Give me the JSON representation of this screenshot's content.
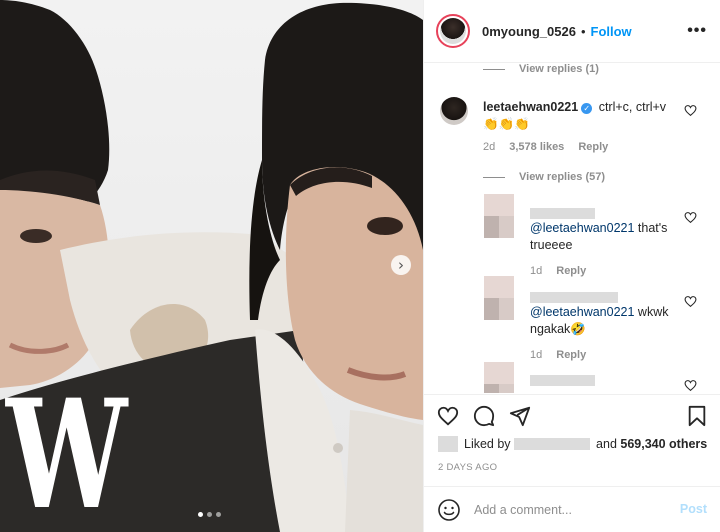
{
  "photo": {
    "magazine_logo": "W",
    "next_icon": "chevron-right-icon",
    "carousel": {
      "count": 3,
      "active": 1
    }
  },
  "header": {
    "username": "0myoung_0526",
    "separator": "•",
    "follow_label": "Follow",
    "more_icon": "•••"
  },
  "comments": {
    "view_replies_top": "View replies (1)",
    "main": {
      "username": "leetaehwan0221",
      "verified_icon": "✓",
      "text": "ctrl+c, ctrl+v",
      "emoji": "👏👏👏",
      "time": "2d",
      "likes": "3,578 likes",
      "reply_label": "Reply",
      "view_replies": "View replies (57)"
    },
    "replies": [
      {
        "mention": "@leetaehwan0221",
        "text": " that's trueeee",
        "time": "1d",
        "reply_label": "Reply"
      },
      {
        "mention": "@leetaehwan0221",
        "text": " wkwk ngakak🤣",
        "time": "1d",
        "reply_label": "Reply"
      }
    ]
  },
  "actions": {
    "liked_by_label": "Liked by",
    "and_label": " and ",
    "others_count": "569,340 others",
    "time_ago": "2 DAYS AGO"
  },
  "composer": {
    "placeholder": "Add a comment...",
    "post_label": "Post"
  },
  "colors": {
    "accent": "#0095f6",
    "post_disabled": "#b2dffc",
    "meta_grey": "#8e8e8e",
    "story_ring": "#e7425a"
  }
}
